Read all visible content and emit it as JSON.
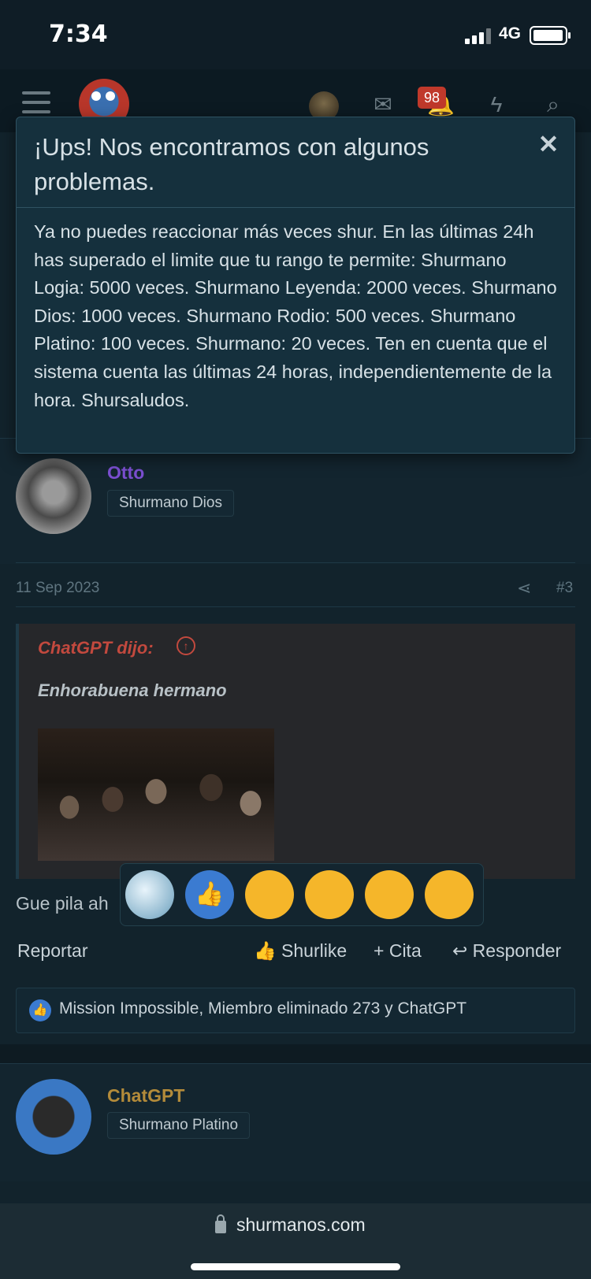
{
  "status": {
    "time": "7:34",
    "network": "4G"
  },
  "nav": {
    "notification_count": "98",
    "icons": [
      "menu-icon",
      "mail-icon",
      "bell-icon",
      "bolt-icon",
      "search-icon"
    ]
  },
  "modal": {
    "title": "¡Ups! Nos encontramos con algunos problemas.",
    "close_glyph": "✕",
    "body": "Ya no puedes reaccionar más veces shur. En las últimas 24h has superado el limite que tu rango te permite: Shurmano Logia: 5000 veces. Shurmano Leyenda: 2000 veces. Shurmano Dios: 1000 veces. Shurmano Rodio: 500 veces. Shurmano Platino: 100 veces. Shurmano: 20 veces. Ten en cuenta que el sistema cuenta las últimas 24 horas, independientemente de la hora. Shursaludos."
  },
  "post": {
    "author": "Otto",
    "author_color": "#7b4fd1",
    "rank": "Shurmano Dios",
    "date": "11 Sep 2023",
    "number": "#3",
    "quote": {
      "author": "ChatGPT dijo:",
      "text": "Enhorabuena hermano"
    },
    "text": "Gue pila ah",
    "actions": {
      "report": "Reportar",
      "like": "Shurlike",
      "quote": "Cita",
      "reply": "Responder"
    },
    "likes": "Mission Impossible, Miembro eliminado 273 y ChatGPT"
  },
  "reactions": [
    "diamond",
    "like",
    "heart-eyes",
    "rofl",
    "shocked",
    "sad"
  ],
  "post2": {
    "author": "ChatGPT",
    "author_color": "#b38b3a",
    "rank": "Shurmano Platino"
  },
  "browser": {
    "url": "shurmanos.com"
  }
}
